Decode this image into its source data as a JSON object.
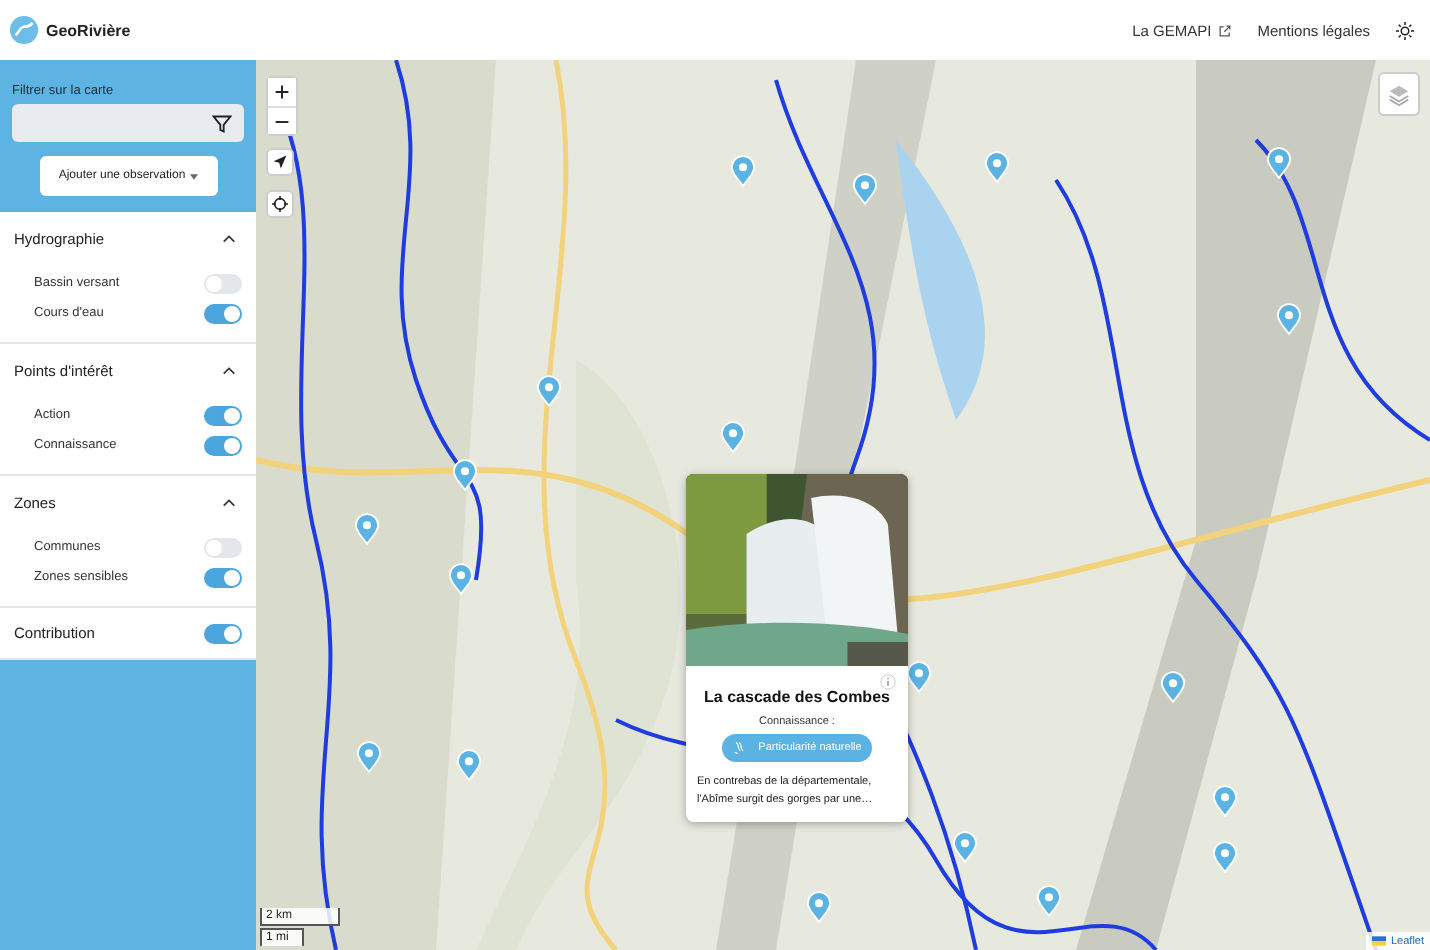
{
  "header": {
    "app_name": "GeoRivière",
    "links": [
      {
        "label": "La GEMAPI",
        "external": true
      },
      {
        "label": "Mentions légales",
        "external": false
      }
    ]
  },
  "sidebar": {
    "filter_label": "Filtrer sur la carte",
    "add_button": "Ajouter une observation",
    "sections": [
      {
        "title": "Hydrographie",
        "expanded": true,
        "layers": [
          {
            "label": "Bassin versant",
            "on": false
          },
          {
            "label": "Cours d'eau",
            "on": true
          }
        ]
      },
      {
        "title": "Points d'intérêt",
        "expanded": true,
        "layers": [
          {
            "label": "Action",
            "on": true
          },
          {
            "label": "Connaissance",
            "on": true
          }
        ]
      },
      {
        "title": "Zones",
        "expanded": true,
        "layers": [
          {
            "label": "Communes",
            "on": false
          },
          {
            "label": "Zones sensibles",
            "on": true
          }
        ]
      }
    ],
    "contribution": {
      "label": "Contribution",
      "on": true
    }
  },
  "map": {
    "popup": {
      "title": "La cascade des Combes",
      "category": "Connaissance :",
      "tag": "Particularité naturelle",
      "description": "En contrebas de la départementale, l'Abîme surgit des gorges par une…"
    },
    "scale": [
      "2 km",
      "1 mi"
    ],
    "attribution": "Leaflet"
  }
}
